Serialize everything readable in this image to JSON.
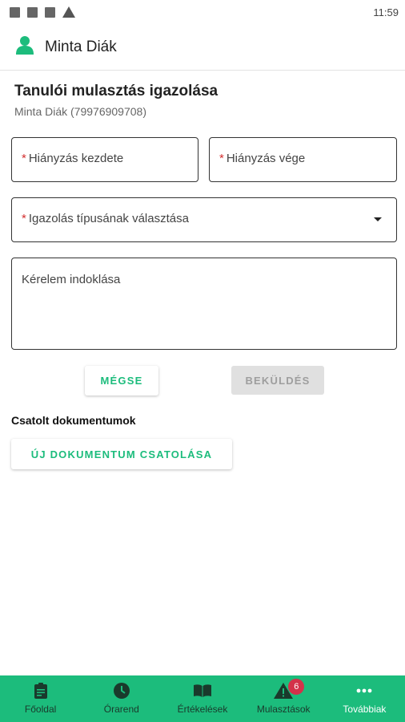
{
  "status_bar": {
    "time": "11:59",
    "icons": [
      "notification-square-icon",
      "notification-square-icon",
      "notification-square-icon",
      "warning-icon"
    ]
  },
  "app_bar": {
    "user_name": "Minta Diák",
    "icon": "person-icon"
  },
  "page": {
    "title": "Tanulói mulasztás igazolása",
    "subtitle": "Minta Diák (79976909708)"
  },
  "form": {
    "required_marker": "*",
    "absence_start_label": "Hiányzás kezdete",
    "absence_end_label": "Hiányzás vége",
    "justification_type_label": "Igazolás típusának választása",
    "reason_label": "Kérelem indoklása"
  },
  "buttons": {
    "cancel": "MÉGSE",
    "submit": "BEKÜLDÉS"
  },
  "attachments": {
    "title": "Csatolt dokumentumok",
    "add_button": "ÚJ DOKUMENTUM CSATOLÁSA"
  },
  "bottom_nav": {
    "items": [
      {
        "label": "Főoldal",
        "icon": "clipboard-icon"
      },
      {
        "label": "Órarend",
        "icon": "clock-icon"
      },
      {
        "label": "Értékelések",
        "icon": "book-icon"
      },
      {
        "label": "Mulasztások",
        "icon": "warning-icon",
        "badge": "6"
      },
      {
        "label": "Továbbiak",
        "icon": "more-dots-icon"
      }
    ]
  },
  "colors": {
    "accent": "#1cbc7c",
    "required": "#d32f2f",
    "badge": "#d3324a"
  }
}
